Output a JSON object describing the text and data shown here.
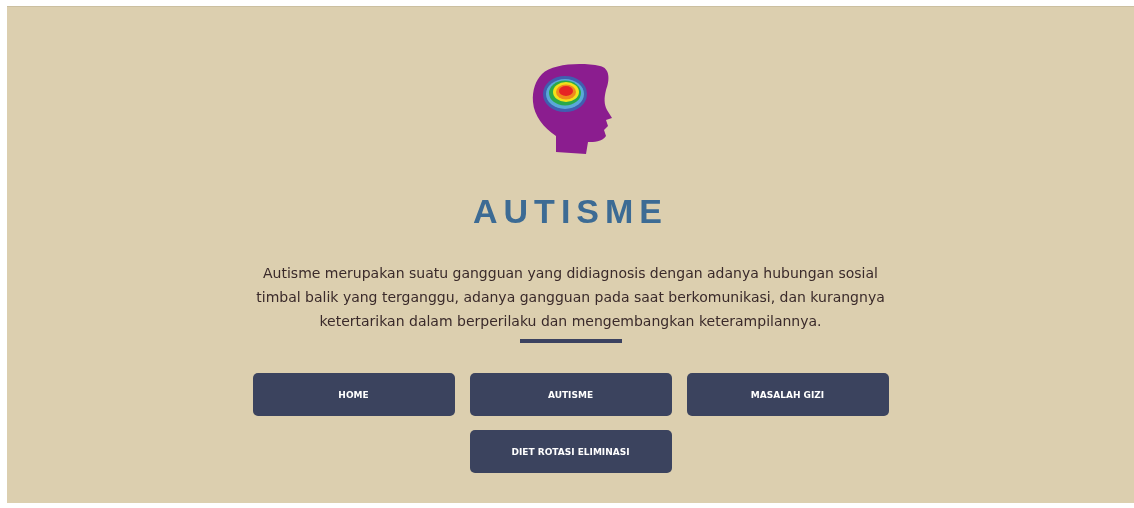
{
  "title": "AUTISME",
  "description": "Autisme merupakan suatu gangguan yang didiagnosis dengan adanya hubungan sosial timbal balik yang terganggu, adanya gangguan pada saat berkomunikasi, dan kurangnya ketertarikan dalam berperilaku dan mengembangkan keterampilannya.",
  "menu": [
    {
      "label": "HOME"
    },
    {
      "label": "AUTISME"
    },
    {
      "label": "MASALAH GIZI"
    },
    {
      "label": "DIET ROTASI ELIMINASI"
    }
  ]
}
